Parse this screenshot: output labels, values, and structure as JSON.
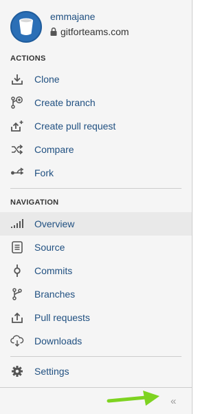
{
  "user": {
    "name": "emmajane",
    "repo": "gitforteams.com"
  },
  "actions": {
    "title": "ACTIONS",
    "items": [
      {
        "label": "Clone",
        "icon": "download-icon"
      },
      {
        "label": "Create branch",
        "icon": "create-branch-icon"
      },
      {
        "label": "Create pull request",
        "icon": "create-pull-request-icon"
      },
      {
        "label": "Compare",
        "icon": "shuffle-icon"
      },
      {
        "label": "Fork",
        "icon": "fork-icon"
      }
    ]
  },
  "navigation": {
    "title": "NAVIGATION",
    "active": "Overview",
    "items": [
      {
        "label": "Overview",
        "icon": "bar-chart-icon"
      },
      {
        "label": "Source",
        "icon": "file-icon"
      },
      {
        "label": "Commits",
        "icon": "commit-icon"
      },
      {
        "label": "Branches",
        "icon": "branch-icon"
      },
      {
        "label": "Pull requests",
        "icon": "upload-icon"
      },
      {
        "label": "Downloads",
        "icon": "cloud-download-icon"
      }
    ]
  },
  "settings": {
    "label": "Settings",
    "icon": "gear-icon"
  },
  "footer": {
    "collapse_glyph": "«"
  },
  "colors": {
    "link": "#205081",
    "icon": "#555555",
    "active_bg": "#e9e9e9",
    "avatar": "#2b6fb6",
    "annotation_arrow": "#7ed321"
  }
}
